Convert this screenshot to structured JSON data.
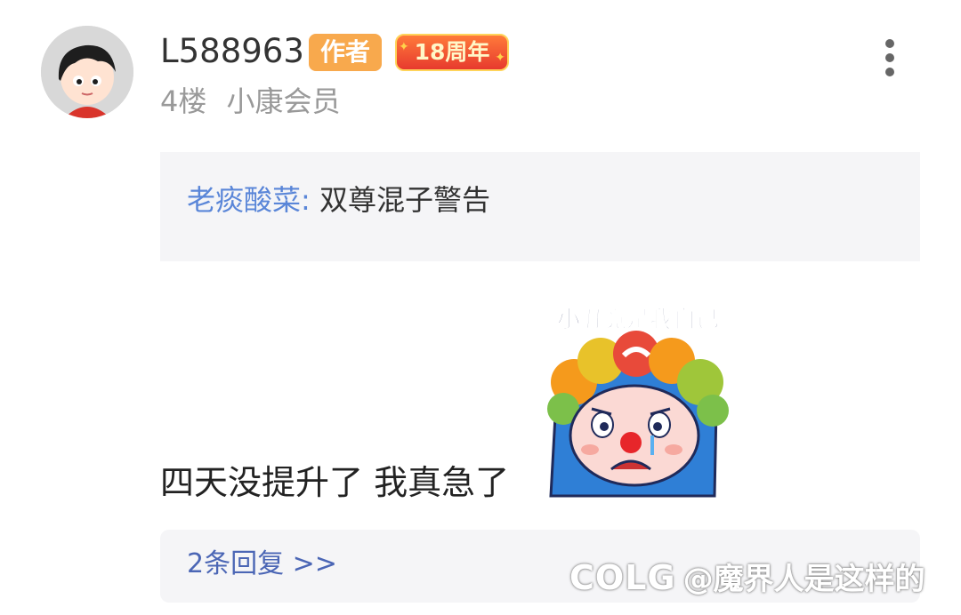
{
  "post": {
    "username": "L588963",
    "author_badge": "作者",
    "anniversary_badge": "18周年",
    "floor": "4楼",
    "member_level": "小康会员",
    "quote": {
      "author": "老痰酸菜:",
      "text": "双尊混子警告"
    },
    "body_text": "四天没提升了  我真急了",
    "sticker_caption": "小丑竟是我自己",
    "replies_link": "2条回复 >>"
  },
  "watermark": {
    "logo": "COLG",
    "text": "@魔界人是这样的"
  },
  "icons": {
    "more": "more-vertical-icon",
    "avatar": "cartoon-avatar"
  },
  "colors": {
    "author_badge": "#f8a94d",
    "quote_author": "#5a86d8",
    "reply_link": "#4b66b5",
    "quote_bg": "#f5f5f7"
  }
}
